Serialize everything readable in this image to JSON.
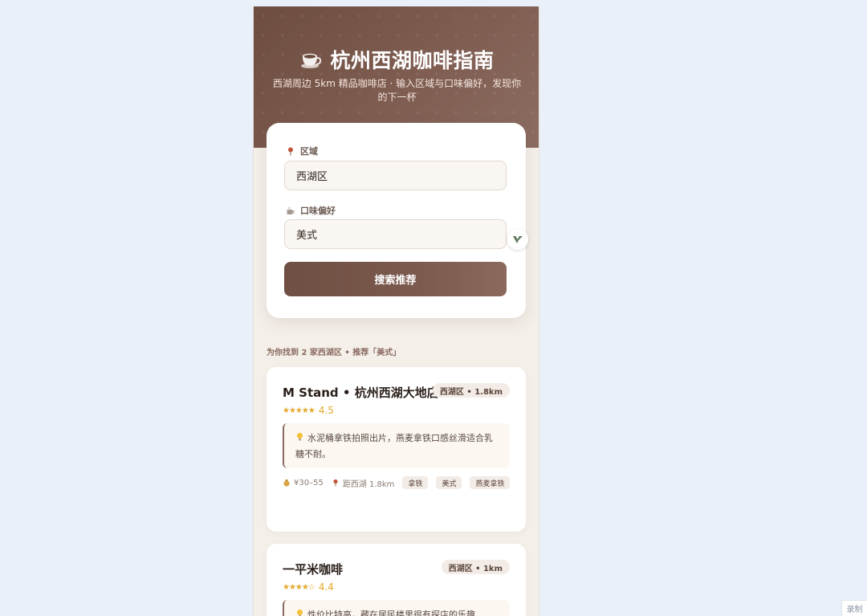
{
  "header": {
    "title": "杭州西湖咖啡指南",
    "subtitle": "西湖周边 5km 精品咖啡店 · 输入区域与口味偏好，发现你的下一杯",
    "icon": "coffee-cup-icon"
  },
  "search": {
    "region_label": "区域",
    "region_value": "西湖区",
    "taste_label": "口味偏好",
    "taste_value": "美式",
    "button_label": "搜索推荐"
  },
  "results": {
    "summary": "为你找到 2 家西湖区 • 推荐「美式」",
    "shops": [
      {
        "name": "M Stand • 杭州西湖大地店",
        "badge": "西湖区 • 1.8km",
        "stars": "★★★★★",
        "rating": "4.5",
        "tip": "水泥桶拿铁拍照出片，燕麦拿铁口感丝滑适合乳糖不耐。",
        "price": "¥30–55",
        "distance": "距西湖 1.8km",
        "tags": [
          "拿铁",
          "美式",
          "燕麦拿铁"
        ]
      },
      {
        "name": "一平米咖啡",
        "badge": "西湖区 • 1km",
        "stars": "★★★★☆",
        "rating": "4.4",
        "tip": "性价比特高，藏在居民楼里很有探店的乐趣"
      }
    ]
  },
  "footer": {
    "record_label": "录制"
  },
  "colors": {
    "brand_brown": "#6e4d41",
    "star_gold": "#e3a92a",
    "page_bg": "#eaf0f9"
  }
}
